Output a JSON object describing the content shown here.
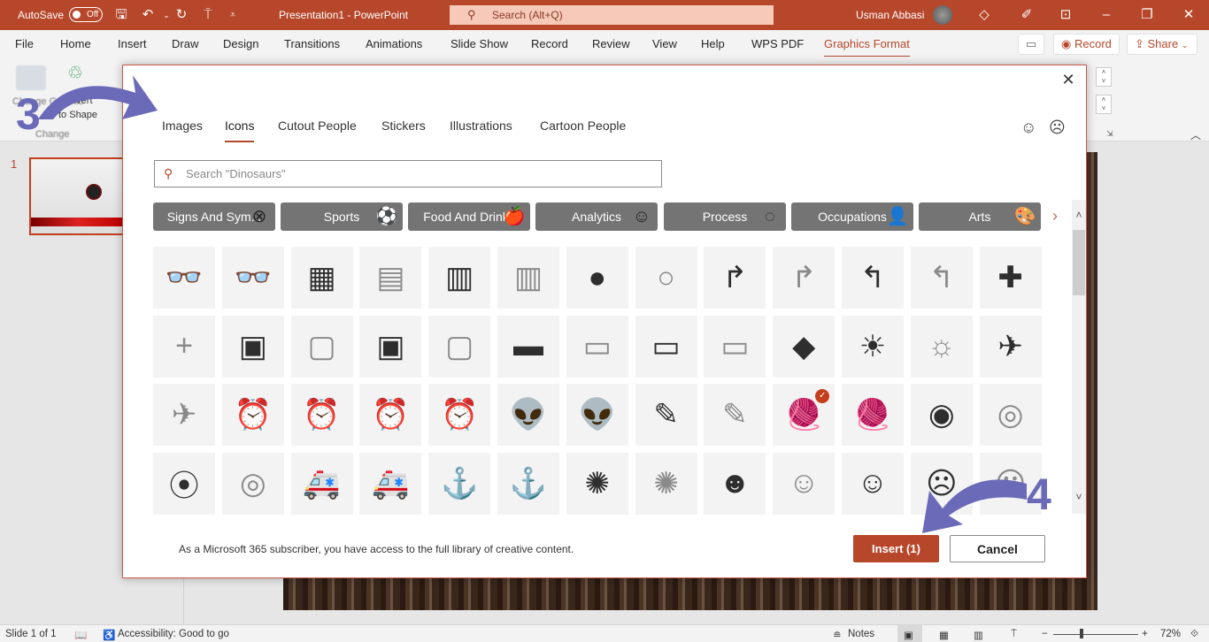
{
  "titlebar": {
    "autosave_label": "AutoSave",
    "autosave_state": "Off",
    "document_title": "Presentation1  -  PowerPoint",
    "search_placeholder": "Search (Alt+Q)",
    "user_name": "Usman Abbasi",
    "icons": [
      "save-icon",
      "undo-icon",
      "redo-icon",
      "present-icon",
      "customize-icon",
      "diamond-icon",
      "pen-icon",
      "ribbon-display-icon",
      "minimize-icon",
      "restore-icon",
      "close-icon"
    ]
  },
  "menubar": {
    "tabs": [
      "File",
      "Home",
      "Insert",
      "Draw",
      "Design",
      "Transitions",
      "Animations",
      "Slide Show",
      "Record",
      "Review",
      "View",
      "Help",
      "WPS PDF",
      "Graphics Format"
    ],
    "active_tab": "Graphics Format",
    "record_label": "Record",
    "share_label": "Share"
  },
  "ribbon": {
    "change_graphic_label": "Change Graphic",
    "convert_label": "Convert to Shape",
    "group_label": "Change"
  },
  "thumbnails": {
    "slide_number": "1"
  },
  "dialog": {
    "tabs": [
      "Images",
      "Icons",
      "Cutout People",
      "Stickers",
      "Illustrations",
      "Cartoon People"
    ],
    "active_tab": "Icons",
    "search_placeholder": "Search \"Dinosaurs\"",
    "categories": [
      {
        "label": "Signs And Sym...",
        "icon": "⊗"
      },
      {
        "label": "Sports",
        "icon": "⚽"
      },
      {
        "label": "Food And Drinks",
        "icon": "🍎"
      },
      {
        "label": "Analytics",
        "icon": "☺"
      },
      {
        "label": "Process",
        "icon": "◌"
      },
      {
        "label": "Occupations",
        "icon": "👤"
      },
      {
        "label": "Arts",
        "icon": "🎨"
      }
    ],
    "icons": [
      [
        {
          "name": "3d-glasses-filled",
          "g": "👓"
        },
        {
          "name": "3d-glasses-outline",
          "g": "👓",
          "light": true
        },
        {
          "name": "abacus-filled",
          "g": "▦"
        },
        {
          "name": "abacus-outline",
          "g": "▤",
          "light": true
        },
        {
          "name": "abacus-vertical-filled",
          "g": "▥"
        },
        {
          "name": "abacus-vertical-outline",
          "g": "▥",
          "light": true
        },
        {
          "name": "acorn-filled",
          "g": "●"
        },
        {
          "name": "acorn-outline",
          "g": "○",
          "light": true
        },
        {
          "name": "merge-right-filled",
          "g": "↱"
        },
        {
          "name": "merge-right-outline",
          "g": "↱",
          "light": true
        },
        {
          "name": "merge-left-filled",
          "g": "↰"
        },
        {
          "name": "merge-left-outline",
          "g": "↰",
          "light": true
        },
        {
          "name": "add-filled",
          "g": "✚"
        }
      ],
      [
        {
          "name": "add-outline",
          "g": "+",
          "light": true
        },
        {
          "name": "address-book-filled",
          "g": "▣"
        },
        {
          "name": "address-book-outline",
          "g": "▢",
          "light": true
        },
        {
          "name": "address-book-right-filled",
          "g": "▣"
        },
        {
          "name": "address-book-right-outline",
          "g": "▢",
          "light": true
        },
        {
          "name": "adhesive-bandage-filled",
          "g": "▬"
        },
        {
          "name": "adhesive-bandage-outline",
          "g": "▭",
          "light": true
        },
        {
          "name": "billboard-filled",
          "g": "▭"
        },
        {
          "name": "billboard-outline",
          "g": "▭",
          "light": true
        },
        {
          "name": "africa-map",
          "g": "◆"
        },
        {
          "name": "agriculture-filled",
          "g": "☀"
        },
        {
          "name": "agriculture-outline",
          "g": "☼",
          "light": true
        },
        {
          "name": "airplane-filled",
          "g": "✈"
        }
      ],
      [
        {
          "name": "airplane-outline",
          "g": "✈",
          "light": true
        },
        {
          "name": "alarm-clock-filled",
          "g": "⏰"
        },
        {
          "name": "alarm-clock-outline",
          "g": "⏰",
          "light": true
        },
        {
          "name": "alarm-ringing-filled",
          "g": "⏰"
        },
        {
          "name": "alarm-ringing-outline",
          "g": "⏰",
          "light": true
        },
        {
          "name": "alien-face-filled",
          "g": "👽"
        },
        {
          "name": "alien-face-outline",
          "g": "👽",
          "light": true
        },
        {
          "name": "needle-thread-filled",
          "g": "✎"
        },
        {
          "name": "needle-thread-outline",
          "g": "✎",
          "light": true
        },
        {
          "name": "knitting-filled",
          "g": "🧶",
          "selected": true
        },
        {
          "name": "knitting-outline",
          "g": "🧶",
          "light": true
        },
        {
          "name": "measuring-tape-filled",
          "g": "◉"
        },
        {
          "name": "measuring-tape-outline",
          "g": "◎",
          "light": true
        }
      ],
      [
        {
          "name": "button-filled",
          "g": "⦿"
        },
        {
          "name": "button-outline",
          "g": "◎",
          "light": true
        },
        {
          "name": "ambulance-filled",
          "g": "🚑"
        },
        {
          "name": "ambulance-outline",
          "g": "🚑",
          "light": true
        },
        {
          "name": "anchor-filled",
          "g": "⚓"
        },
        {
          "name": "anchor-outline",
          "g": "⚓",
          "light": true
        },
        {
          "name": "anemone-filled",
          "g": "✺"
        },
        {
          "name": "anemone-outline",
          "g": "✺",
          "light": true
        },
        {
          "name": "angel-face-filled",
          "g": "☻"
        },
        {
          "name": "angel-face-outline",
          "g": "☺",
          "light": true
        },
        {
          "name": "angel-face-medium",
          "g": "☺"
        },
        {
          "name": "angry-face-filled",
          "g": "☹"
        },
        {
          "name": "angry-face-outline",
          "g": "☹",
          "light": true
        }
      ]
    ],
    "footer_note": "As a Microsoft 365 subscriber, you have access to the full library of creative content.",
    "insert_label": "Insert (1)",
    "cancel_label": "Cancel",
    "selected_count": 1
  },
  "annotations": {
    "step3": "3",
    "step4": "4"
  },
  "statusbar": {
    "slide_info": "Slide 1 of 1",
    "accessibility": "Accessibility: Good to go",
    "notes_label": "Notes",
    "zoom_level": "72%"
  },
  "colors": {
    "accent": "#b7472a",
    "category_bg": "#747474",
    "annotation": "#6a6ab8"
  }
}
